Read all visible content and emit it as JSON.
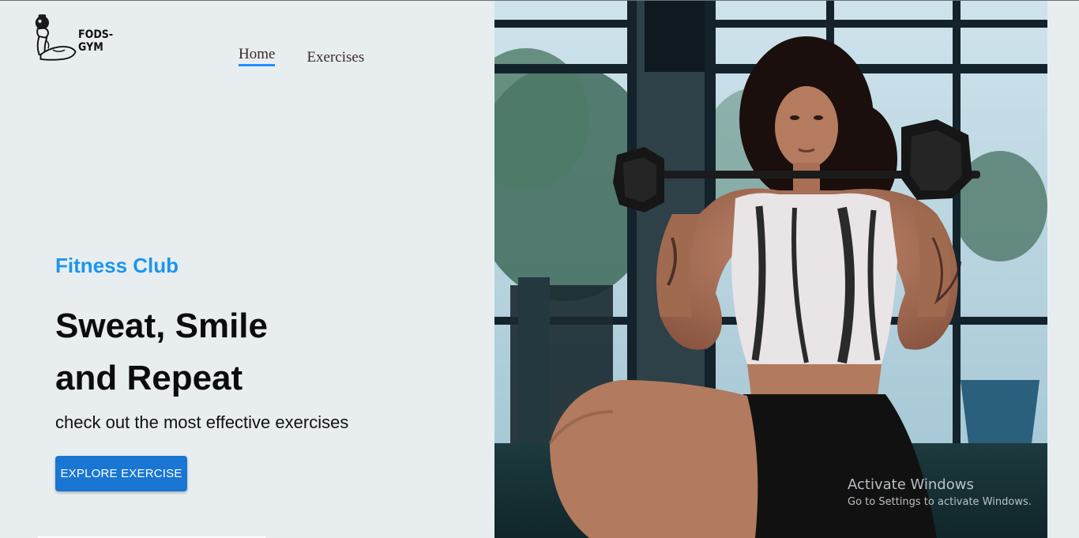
{
  "brand": {
    "name": "FODS-GYM",
    "accent_color": "#1976d2",
    "highlight_color": "#1d95ee"
  },
  "nav": {
    "items": [
      {
        "label": "Home",
        "active": true
      },
      {
        "label": "Exercises",
        "active": false
      }
    ]
  },
  "hero": {
    "subtitle": "Fitness Club",
    "title_line1": "Sweat, Smile",
    "title_line2": "and Repeat",
    "description": "check out the most effective exercises",
    "cta_label": "EXPLORE EXERCISE"
  },
  "watermark": {
    "title": "Activate Windows",
    "subtitle": "Go to Settings to activate Windows."
  }
}
